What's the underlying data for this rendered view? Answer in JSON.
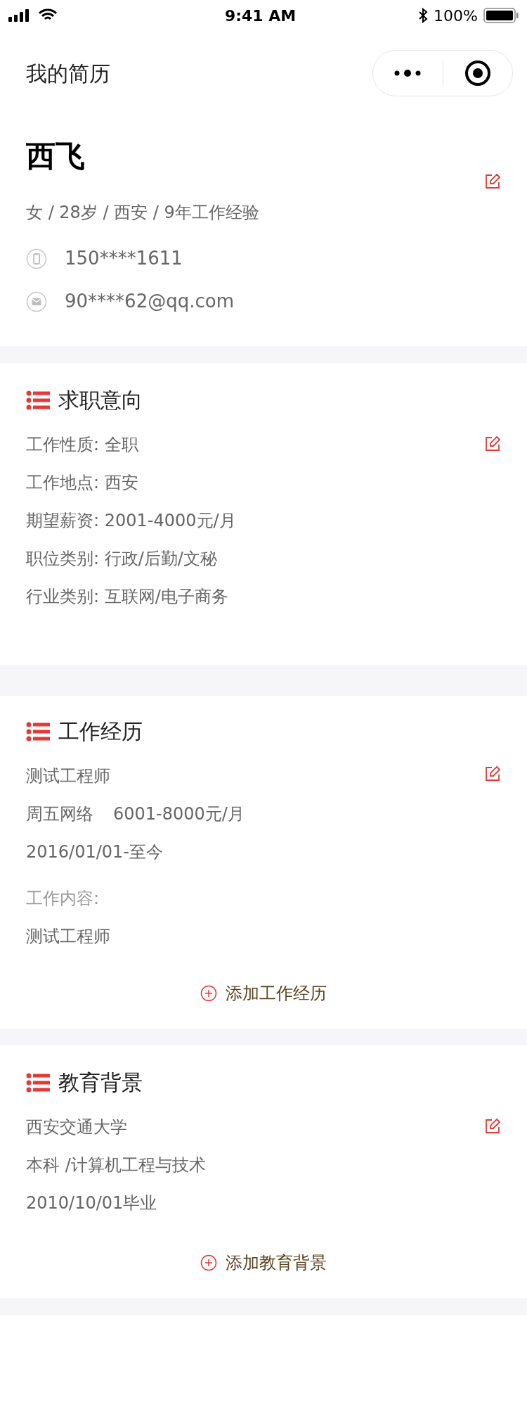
{
  "status_bar": {
    "time": "9:41 AM",
    "battery": "100%"
  },
  "nav": {
    "title": "我的简历"
  },
  "profile": {
    "name": "西飞",
    "summary": "女 / 28岁 / 西安 / 9年工作经验",
    "contacts": [
      {
        "kind": "phone",
        "text": "150****1611"
      },
      {
        "kind": "email",
        "text": "90****62@qq.com"
      }
    ]
  },
  "intent": {
    "title": "求职意向",
    "rows": [
      "工作性质: 全职",
      "工作地点: 西安",
      "期望薪资: 2001-4000元/月",
      "职位类别: 行政/后勤/文秘",
      "行业类别: 互联网/电子商务"
    ]
  },
  "work": {
    "title": "工作经历",
    "entries": [
      {
        "position": "测试工程师",
        "company": "周五网络",
        "salary": "6001-8000元/月",
        "period": "2016/01/01-至今",
        "content_label": "工作内容:",
        "content": "测试工程师"
      }
    ],
    "add_button": "添加工作经历"
  },
  "education": {
    "title": "教育背景",
    "entries": [
      {
        "school": "西安交通大学",
        "major": "本科 /计算机工程与技术",
        "graduation": "2010/10/01毕业"
      }
    ],
    "add_button": "添加教育背景"
  }
}
